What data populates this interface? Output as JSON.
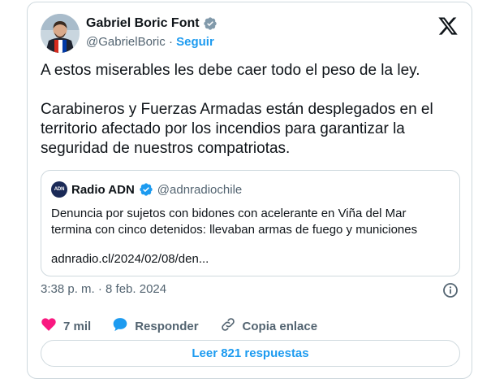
{
  "author": {
    "name": "Gabriel Boric Font",
    "handle": "@GabrielBoric",
    "separator": "·",
    "follow_label": "Seguir"
  },
  "tweet": {
    "paragraphs": [
      "A estos miserables les debe caer todo el peso de la ley.",
      "Carabineros y Fuerzas Armadas están desplegados en el territorio afectado por los incendios para garantizar la seguridad de nuestros compatriotas."
    ]
  },
  "quote": {
    "logo_text": "ADN",
    "name": "Radio ADN",
    "handle": "@adnradiochile",
    "text": "Denuncia por sujetos con bidones con acelerante en Viña del Mar termina con cinco detenidos: llevaban armas de fuego y municiones",
    "link": "adnradio.cl/2024/02/08/den..."
  },
  "meta": {
    "time": "3:38 p. m. · 8 feb. 2024"
  },
  "actions": {
    "likes": "7 mil",
    "reply_label": "Responder",
    "copy_label": "Copia enlace"
  },
  "read_replies_label": "Leer 821 respuestas",
  "icons": {
    "verified": "verified-badge-icon",
    "x": "x-logo-icon",
    "info": "info-icon",
    "heart": "heart-icon",
    "reply": "speech-bubble-icon",
    "link": "link-icon"
  },
  "colors": {
    "accent": "#1d9bf0",
    "like": "#f91880",
    "muted": "#536471",
    "text": "#0f1419",
    "border": "#cfd9de"
  }
}
